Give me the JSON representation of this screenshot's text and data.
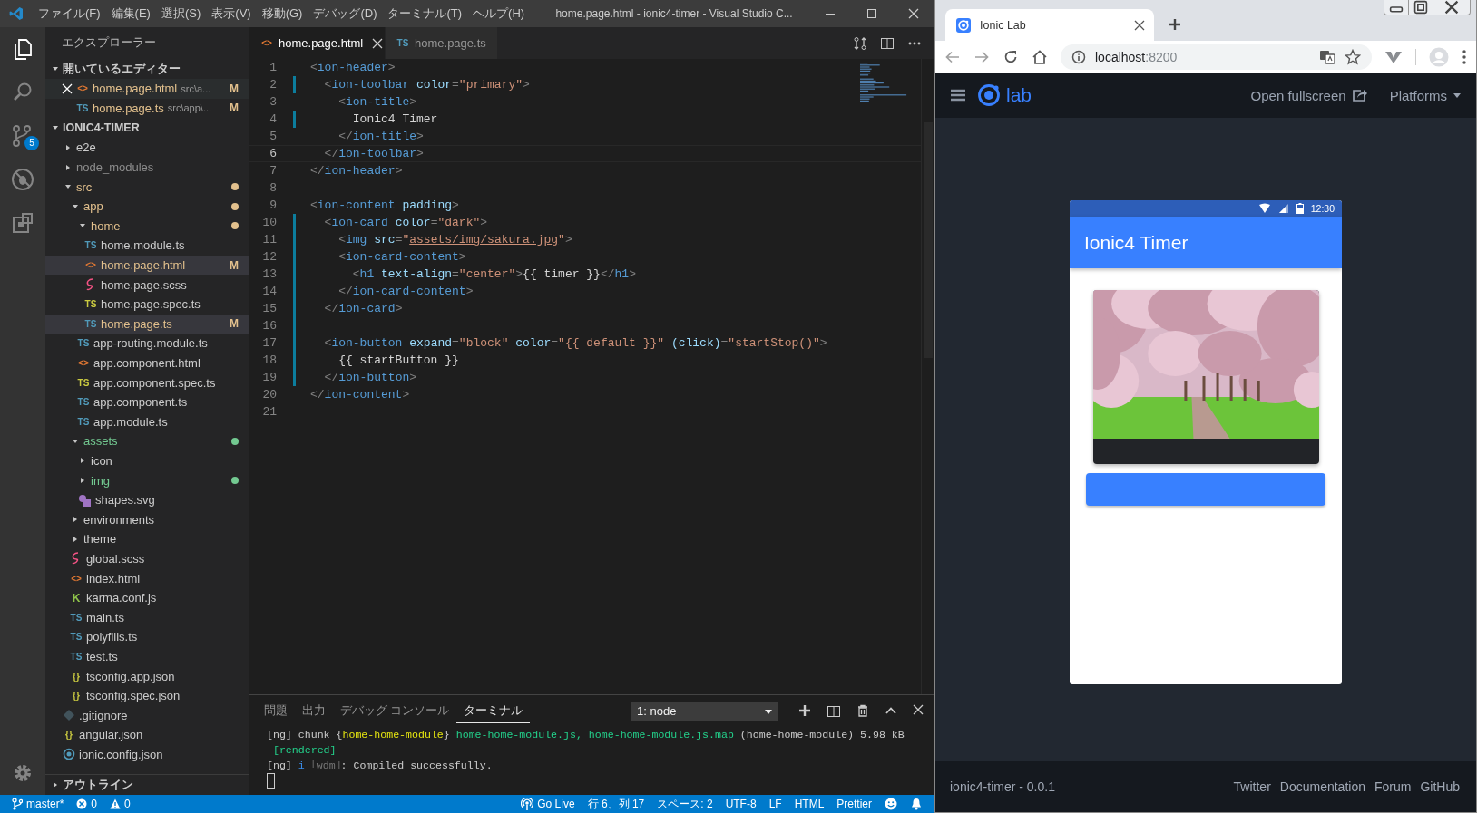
{
  "window": {
    "title": "home.page.html - ionic4-timer - Visual Studio C...",
    "menu": [
      "ファイル(F)",
      "編集(E)",
      "選択(S)",
      "表示(V)",
      "移動(G)",
      "デバッグ(D)",
      "ターミナル(T)",
      "ヘルプ(H)"
    ]
  },
  "activity_bar": [
    {
      "kind": "files",
      "selected": true
    },
    {
      "kind": "search",
      "selected": false
    },
    {
      "kind": "source-control",
      "selected": false,
      "badge": "5"
    },
    {
      "kind": "debug",
      "selected": false
    },
    {
      "kind": "extensions",
      "selected": false
    }
  ],
  "sidebar": {
    "title": "エクスプローラー",
    "open_editors": {
      "title": "開いているエディター",
      "expanded": true,
      "items": [
        {
          "name": "home.page.html",
          "path": "src\\a...",
          "badge": "M",
          "icon": {
            "kind": "html",
            "glyph": "<>"
          },
          "selected": true
        },
        {
          "name": "home.page.ts",
          "path": "src\\app\\...",
          "badge": "M",
          "icon": {
            "kind": "ts",
            "glyph": "TS"
          },
          "selected": false
        }
      ]
    },
    "project": {
      "title": "IONIC4-TIMER",
      "expanded": true,
      "items": [
        {
          "name": "e2e",
          "kind": "folder",
          "expanded": false,
          "color": "#cccccc",
          "dot": false,
          "selected": false
        },
        {
          "name": "node_modules",
          "kind": "folder",
          "expanded": false,
          "color": "#8c8c8c",
          "dot": false,
          "selected": false
        },
        {
          "name": "src",
          "kind": "folder",
          "expanded": true,
          "color": "#e2c08d",
          "dot": true,
          "selected": false,
          "children": [
            {
              "name": "app",
              "kind": "folder",
              "expanded": true,
              "color": "#e2c08d",
              "dot": true,
              "selected": false,
              "children": [
                {
                  "name": "home",
                  "kind": "folder",
                  "expanded": true,
                  "color": "#e2c08d",
                  "dot": true,
                  "selected": false,
                  "children": [
                    {
                      "name": "home.module.ts",
                      "kind": "file",
                      "icon": {
                        "kind": "ts",
                        "glyph": "TS"
                      },
                      "color": "#cccccc",
                      "selected": false
                    },
                    {
                      "name": "home.page.html",
                      "kind": "file",
                      "icon": {
                        "kind": "html",
                        "glyph": "<>"
                      },
                      "color": "#e2c08d",
                      "badge": "M",
                      "selected": true
                    },
                    {
                      "name": "home.page.scss",
                      "kind": "file",
                      "icon": {
                        "kind": "scss"
                      },
                      "color": "#cccccc",
                      "selected": false
                    },
                    {
                      "name": "home.page.spec.ts",
                      "kind": "file",
                      "icon": {
                        "kind": "ts-spec",
                        "glyph": "TS"
                      },
                      "color": "#cccccc",
                      "selected": false
                    },
                    {
                      "name": "home.page.ts",
                      "kind": "file",
                      "icon": {
                        "kind": "ts",
                        "glyph": "TS"
                      },
                      "color": "#e2c08d",
                      "badge": "M",
                      "selected": true
                    }
                  ]
                },
                {
                  "name": "app-routing.module.ts",
                  "kind": "file",
                  "icon": {
                    "kind": "ts",
                    "glyph": "TS"
                  },
                  "color": "#cccccc",
                  "selected": false
                },
                {
                  "name": "app.component.html",
                  "kind": "file",
                  "icon": {
                    "kind": "html",
                    "glyph": "<>"
                  },
                  "color": "#cccccc",
                  "selected": false
                },
                {
                  "name": "app.component.spec.ts",
                  "kind": "file",
                  "icon": {
                    "kind": "ts-spec",
                    "glyph": "TS"
                  },
                  "color": "#cccccc",
                  "selected": false
                },
                {
                  "name": "app.component.ts",
                  "kind": "file",
                  "icon": {
                    "kind": "ts",
                    "glyph": "TS"
                  },
                  "color": "#cccccc",
                  "selected": false
                },
                {
                  "name": "app.module.ts",
                  "kind": "file",
                  "icon": {
                    "kind": "ts",
                    "glyph": "TS"
                  },
                  "color": "#cccccc",
                  "selected": false
                }
              ]
            },
            {
              "name": "assets",
              "kind": "folder",
              "expanded": true,
              "color": "#73c991",
              "dot": true,
              "selected": false,
              "children": [
                {
                  "name": "icon",
                  "kind": "folder",
                  "expanded": false,
                  "color": "#cccccc",
                  "dot": false,
                  "selected": false
                },
                {
                  "name": "img",
                  "kind": "folder",
                  "expanded": false,
                  "color": "#73c991",
                  "dot": true,
                  "selected": false
                },
                {
                  "name": "shapes.svg",
                  "kind": "file",
                  "icon": {
                    "kind": "svg"
                  },
                  "color": "#cccccc",
                  "selected": false
                }
              ]
            },
            {
              "name": "environments",
              "kind": "folder",
              "expanded": false,
              "color": "#cccccc",
              "dot": false,
              "selected": false
            },
            {
              "name": "theme",
              "kind": "folder",
              "expanded": false,
              "color": "#cccccc",
              "dot": false,
              "selected": false
            },
            {
              "name": "global.scss",
              "kind": "file",
              "icon": {
                "kind": "scss"
              },
              "color": "#cccccc",
              "selected": false
            },
            {
              "name": "index.html",
              "kind": "file",
              "icon": {
                "kind": "html",
                "glyph": "<>"
              },
              "color": "#cccccc",
              "selected": false
            },
            {
              "name": "karma.conf.js",
              "kind": "file",
              "icon": {
                "kind": "karma",
                "glyph": "K"
              },
              "color": "#cccccc",
              "selected": false
            },
            {
              "name": "main.ts",
              "kind": "file",
              "icon": {
                "kind": "ts",
                "glyph": "TS"
              },
              "color": "#cccccc",
              "selected": false
            },
            {
              "name": "polyfills.ts",
              "kind": "file",
              "icon": {
                "kind": "ts",
                "glyph": "TS"
              },
              "color": "#cccccc",
              "selected": false
            },
            {
              "name": "test.ts",
              "kind": "file",
              "icon": {
                "kind": "ts",
                "glyph": "TS"
              },
              "color": "#cccccc",
              "selected": false
            },
            {
              "name": "tsconfig.app.json",
              "kind": "file",
              "icon": {
                "kind": "json",
                "glyph": "{}"
              },
              "color": "#cccccc",
              "selected": false
            },
            {
              "name": "tsconfig.spec.json",
              "kind": "file",
              "icon": {
                "kind": "json",
                "glyph": "{}"
              },
              "color": "#cccccc",
              "selected": false
            }
          ]
        },
        {
          "name": ".gitignore",
          "kind": "file",
          "icon": {
            "kind": "git"
          },
          "color": "#cccccc",
          "selected": false
        },
        {
          "name": "angular.json",
          "kind": "file",
          "icon": {
            "kind": "json",
            "glyph": "{}"
          },
          "color": "#cccccc",
          "selected": false
        },
        {
          "name": "ionic.config.json",
          "kind": "file",
          "icon": {
            "kind": "ionic"
          },
          "color": "#cccccc",
          "selected": false
        }
      ]
    },
    "outline": {
      "title": "アウトライン",
      "expanded": false
    }
  },
  "editor": {
    "tabs": [
      {
        "label": "home.page.html",
        "icon": {
          "kind": "html",
          "glyph": "<>"
        },
        "selected": true
      },
      {
        "label": "home.page.ts",
        "icon": {
          "kind": "ts",
          "glyph": "TS"
        },
        "selected": false
      }
    ],
    "lines": [
      {
        "n": "1",
        "modified": false,
        "current": false,
        "tokens": [
          {
            "kind": "punct",
            "t": "<"
          },
          {
            "kind": "tag",
            "t": "ion-header"
          },
          {
            "kind": "punct",
            "t": ">"
          }
        ]
      },
      {
        "n": "2",
        "modified": true,
        "current": false,
        "tokens": [
          {
            "kind": "punct",
            "t": "  <"
          },
          {
            "kind": "tag",
            "t": "ion-toolbar"
          },
          {
            "kind": "attr",
            "t": " color"
          },
          {
            "kind": "punct",
            "t": "="
          },
          {
            "kind": "string",
            "t": "\"primary\""
          },
          {
            "kind": "punct",
            "t": ">"
          }
        ]
      },
      {
        "n": "3",
        "modified": false,
        "current": false,
        "tokens": [
          {
            "kind": "punct",
            "t": "    <"
          },
          {
            "kind": "tag",
            "t": "ion-title"
          },
          {
            "kind": "punct",
            "t": ">"
          }
        ]
      },
      {
        "n": "4",
        "modified": true,
        "current": false,
        "tokens": [
          {
            "kind": "text",
            "t": "      Ionic4 Timer"
          }
        ]
      },
      {
        "n": "5",
        "modified": false,
        "current": false,
        "tokens": [
          {
            "kind": "punct",
            "t": "    </"
          },
          {
            "kind": "tag",
            "t": "ion-title"
          },
          {
            "kind": "punct",
            "t": ">"
          }
        ]
      },
      {
        "n": "6",
        "modified": false,
        "current": true,
        "tokens": [
          {
            "kind": "punct",
            "t": "  </"
          },
          {
            "kind": "tag",
            "t": "ion-toolbar"
          },
          {
            "kind": "punct",
            "t": ">"
          }
        ]
      },
      {
        "n": "7",
        "modified": false,
        "current": false,
        "tokens": [
          {
            "kind": "punct",
            "t": "</"
          },
          {
            "kind": "tag",
            "t": "ion-header"
          },
          {
            "kind": "punct",
            "t": ">"
          }
        ]
      },
      {
        "n": "8",
        "modified": false,
        "current": false
      },
      {
        "n": "9",
        "modified": false,
        "current": false,
        "tokens": [
          {
            "kind": "punct",
            "t": "<"
          },
          {
            "kind": "tag",
            "t": "ion-content"
          },
          {
            "kind": "attr",
            "t": " padding"
          },
          {
            "kind": "punct",
            "t": ">"
          }
        ]
      },
      {
        "n": "10",
        "modified": true,
        "current": false,
        "tokens": [
          {
            "kind": "punct",
            "t": "  <"
          },
          {
            "kind": "tag",
            "t": "ion-card"
          },
          {
            "kind": "attr",
            "t": " color"
          },
          {
            "kind": "punct",
            "t": "="
          },
          {
            "kind": "string",
            "t": "\"dark\""
          },
          {
            "kind": "punct",
            "t": ">"
          }
        ]
      },
      {
        "n": "11",
        "modified": true,
        "current": false,
        "tokens": [
          {
            "kind": "punct",
            "t": "    <"
          },
          {
            "kind": "tag",
            "t": "img"
          },
          {
            "kind": "attr",
            "t": " src"
          },
          {
            "kind": "punct",
            "t": "="
          },
          {
            "kind": "string",
            "t": "\""
          },
          {
            "kind": "link",
            "t": "assets/img/sakura.jpg"
          },
          {
            "kind": "string",
            "t": "\""
          },
          {
            "kind": "punct",
            "t": ">"
          }
        ]
      },
      {
        "n": "12",
        "modified": true,
        "current": false,
        "tokens": [
          {
            "kind": "punct",
            "t": "    <"
          },
          {
            "kind": "tag",
            "t": "ion-card-content"
          },
          {
            "kind": "punct",
            "t": ">"
          }
        ]
      },
      {
        "n": "13",
        "modified": true,
        "current": false,
        "tokens": [
          {
            "kind": "punct",
            "t": "      <"
          },
          {
            "kind": "tag",
            "t": "h1"
          },
          {
            "kind": "attr",
            "t": " text-align"
          },
          {
            "kind": "punct",
            "t": "="
          },
          {
            "kind": "string",
            "t": "\"center\""
          },
          {
            "kind": "punct",
            "t": ">"
          },
          {
            "kind": "text",
            "t": "{{ timer }}"
          },
          {
            "kind": "punct",
            "t": "</"
          },
          {
            "kind": "tag",
            "t": "h1"
          },
          {
            "kind": "punct",
            "t": ">"
          }
        ]
      },
      {
        "n": "14",
        "modified": true,
        "current": false,
        "tokens": [
          {
            "kind": "punct",
            "t": "    </"
          },
          {
            "kind": "tag",
            "t": "ion-card-content"
          },
          {
            "kind": "punct",
            "t": ">"
          }
        ]
      },
      {
        "n": "15",
        "modified": true,
        "current": false,
        "tokens": [
          {
            "kind": "punct",
            "t": "  </"
          },
          {
            "kind": "tag",
            "t": "ion-card"
          },
          {
            "kind": "punct",
            "t": ">"
          }
        ]
      },
      {
        "n": "16",
        "modified": true,
        "current": false
      },
      {
        "n": "17",
        "modified": true,
        "current": false,
        "tokens": [
          {
            "kind": "punct",
            "t": "  <"
          },
          {
            "kind": "tag",
            "t": "ion-button"
          },
          {
            "kind": "attr",
            "t": " expand"
          },
          {
            "kind": "punct",
            "t": "="
          },
          {
            "kind": "string",
            "t": "\"block\""
          },
          {
            "kind": "attr",
            "t": " color"
          },
          {
            "kind": "punct",
            "t": "="
          },
          {
            "kind": "string",
            "t": "\"{{ default }}\""
          },
          {
            "kind": "attr",
            "t": " (click)"
          },
          {
            "kind": "punct",
            "t": "="
          },
          {
            "kind": "string",
            "t": "\"startStop()\""
          },
          {
            "kind": "punct",
            "t": ">"
          }
        ]
      },
      {
        "n": "18",
        "modified": true,
        "current": false,
        "tokens": [
          {
            "kind": "text",
            "t": "    {{ startButton }}"
          }
        ]
      },
      {
        "n": "19",
        "modified": true,
        "current": false,
        "tokens": [
          {
            "kind": "punct",
            "t": "  </"
          },
          {
            "kind": "tag",
            "t": "ion-button"
          },
          {
            "kind": "punct",
            "t": ">"
          }
        ]
      },
      {
        "n": "20",
        "modified": false,
        "current": false,
        "tokens": [
          {
            "kind": "punct",
            "t": "</"
          },
          {
            "kind": "tag",
            "t": "ion-content"
          },
          {
            "kind": "punct",
            "t": ">"
          }
        ]
      },
      {
        "n": "21",
        "modified": false,
        "current": false
      }
    ]
  },
  "panel": {
    "tabs": [
      {
        "label": "問題",
        "selected": false
      },
      {
        "label": "出力",
        "selected": false
      },
      {
        "label": "デバッグ コンソール",
        "selected": false
      },
      {
        "label": "ターミナル",
        "selected": true
      }
    ],
    "terminal_select": "1: node",
    "lines": [
      [
        {
          "kind": "plain",
          "t": "[ng] chunk {"
        },
        {
          "kind": "module",
          "t": "home-home-module"
        },
        {
          "kind": "plain",
          "t": "} "
        },
        {
          "kind": "file",
          "t": "home-home-module.js, home-home-module.js.map"
        },
        {
          "kind": "plain",
          "t": " (home-home-module) 5.98 kB"
        }
      ],
      [
        {
          "kind": "file",
          "t": " [rendered]"
        }
      ],
      [
        {
          "kind": "plain",
          "t": "[ng] "
        },
        {
          "kind": "info",
          "t": "i"
        },
        {
          "kind": "dim",
          "t": " ｢wdm｣"
        },
        {
          "kind": "plain",
          "t": ": Compiled successfully."
        }
      ]
    ]
  },
  "status_bar": {
    "left": [
      {
        "kind": "branch",
        "text": "master*"
      },
      {
        "kind": "errors",
        "text": "0"
      },
      {
        "kind": "warnings",
        "text": "0"
      }
    ],
    "right": [
      {
        "kind": "live",
        "text": "Go Live"
      },
      {
        "kind": "plain",
        "text": "行 6、列 17"
      },
      {
        "kind": "plain",
        "text": "スペース: 2"
      },
      {
        "kind": "plain",
        "text": "UTF-8"
      },
      {
        "kind": "plain",
        "text": "LF"
      },
      {
        "kind": "plain",
        "text": "HTML"
      },
      {
        "kind": "plain",
        "text": "Prettier"
      },
      {
        "kind": "feedback"
      },
      {
        "kind": "bell"
      }
    ]
  },
  "browser": {
    "tab": {
      "title": "Ionic Lab"
    },
    "address": {
      "host": "localhost",
      "port": ":8200"
    },
    "lab": {
      "brand": "lab",
      "open_fullscreen": "Open fullscreen",
      "platforms": "Platforms"
    },
    "phone": {
      "time": "12:30",
      "title": "Ionic4 Timer"
    },
    "footer": {
      "version": "ionic4-timer - 0.0.1",
      "links": [
        "Twitter",
        "Documentation",
        "Forum",
        "GitHub"
      ]
    }
  }
}
